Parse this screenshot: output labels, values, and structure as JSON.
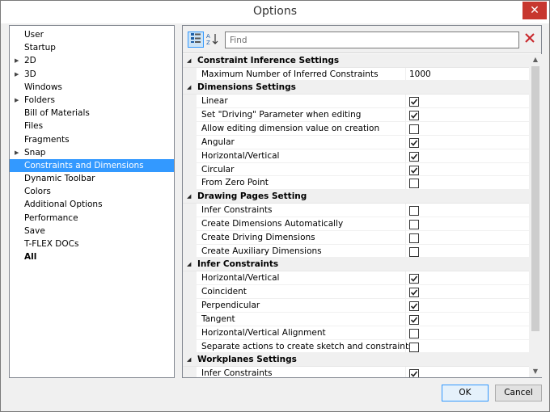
{
  "window": {
    "title": "Options",
    "close_symbol": "✕"
  },
  "tree": [
    {
      "label": "User",
      "expandable": false
    },
    {
      "label": "Startup",
      "expandable": false
    },
    {
      "label": "2D",
      "expandable": true
    },
    {
      "label": "3D",
      "expandable": true
    },
    {
      "label": "Windows",
      "expandable": false
    },
    {
      "label": "Folders",
      "expandable": true
    },
    {
      "label": "Bill of Materials",
      "expandable": false
    },
    {
      "label": "Files",
      "expandable": false
    },
    {
      "label": "Fragments",
      "expandable": false
    },
    {
      "label": "Snap",
      "expandable": true
    },
    {
      "label": "Constraints and Dimensions",
      "expandable": false,
      "selected": true
    },
    {
      "label": "Dynamic Toolbar",
      "expandable": false
    },
    {
      "label": "Colors",
      "expandable": false
    },
    {
      "label": "Additional Options",
      "expandable": false
    },
    {
      "label": "Performance",
      "expandable": false
    },
    {
      "label": "Save",
      "expandable": false
    },
    {
      "label": "T-FLEX DOCs",
      "expandable": false
    },
    {
      "label": "All",
      "expandable": false,
      "bold": true
    }
  ],
  "toolbar": {
    "find_placeholder": "Find",
    "categorized_icon": "categorized-icon",
    "sort_icon": "sort-az-icon",
    "clear_icon": "clear-icon"
  },
  "sections": [
    {
      "title": "Constraint Inference Settings",
      "rows": [
        {
          "name": "Maximum Number of Inferred Constraints",
          "type": "text",
          "value": "1000"
        }
      ]
    },
    {
      "title": "Dimensions Settings",
      "rows": [
        {
          "name": "Linear",
          "type": "check",
          "checked": true
        },
        {
          "name": "Set \"Driving\" Parameter when editing",
          "type": "check",
          "checked": true
        },
        {
          "name": "Allow editing dimension value on creation",
          "type": "check",
          "checked": false
        },
        {
          "name": "Angular",
          "type": "check",
          "checked": true
        },
        {
          "name": "Horizontal/Vertical",
          "type": "check",
          "checked": true
        },
        {
          "name": "Circular",
          "type": "check",
          "checked": true
        },
        {
          "name": "From Zero Point",
          "type": "check",
          "checked": false
        }
      ]
    },
    {
      "title": "Drawing Pages Setting",
      "rows": [
        {
          "name": "Infer Constraints",
          "type": "check",
          "checked": false
        },
        {
          "name": "Create Dimensions Automatically",
          "type": "check",
          "checked": false
        },
        {
          "name": "Create Driving Dimensions",
          "type": "check",
          "checked": false
        },
        {
          "name": "Create Auxiliary Dimensions",
          "type": "check",
          "checked": false
        }
      ]
    },
    {
      "title": "Infer Constraints",
      "rows": [
        {
          "name": "Horizontal/Vertical",
          "type": "check",
          "checked": true
        },
        {
          "name": "Coincident",
          "type": "check",
          "checked": true
        },
        {
          "name": "Perpendicular",
          "type": "check",
          "checked": true
        },
        {
          "name": "Tangent",
          "type": "check",
          "checked": true
        },
        {
          "name": "Horizontal/Vertical Alignment",
          "type": "check",
          "checked": false
        },
        {
          "name": "Separate actions to create sketch and constraints",
          "type": "check",
          "checked": false
        }
      ]
    },
    {
      "title": "Workplanes Settings",
      "rows": [
        {
          "name": "Infer Constraints",
          "type": "check",
          "checked": true
        },
        {
          "name": "",
          "type": "check",
          "checked": false
        }
      ]
    }
  ],
  "buttons": {
    "ok": "OK",
    "cancel": "Cancel"
  },
  "colors": {
    "selection": "#3399ff",
    "close": "#c7372f",
    "clear": "#c8262b"
  }
}
